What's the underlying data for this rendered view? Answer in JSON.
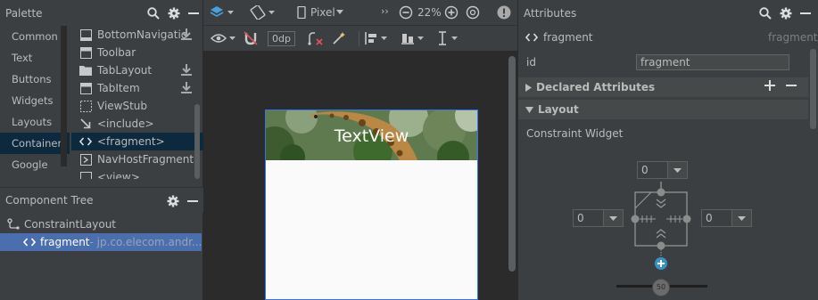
{
  "palette": {
    "title": "Palette",
    "categories": [
      "Common",
      "Text",
      "Buttons",
      "Widgets",
      "Layouts",
      "Container",
      "Google"
    ],
    "selected_category": "Container",
    "items": [
      {
        "label": "BottomNavigatio",
        "icon": "bottom-nav-icon",
        "download": true
      },
      {
        "label": "Toolbar",
        "icon": "toolbar-icon",
        "download": false
      },
      {
        "label": "TabLayout",
        "icon": "folder-icon",
        "download": true
      },
      {
        "label": "TabItem",
        "icon": "tab-item-icon",
        "download": true
      },
      {
        "label": "ViewStub",
        "icon": "viewstub-icon",
        "download": false
      },
      {
        "label": "<include>",
        "icon": "include-arrow-icon",
        "download": false
      },
      {
        "label": "<fragment>",
        "icon": "code-brackets-icon",
        "download": false
      },
      {
        "label": "NavHostFragment",
        "icon": "nav-host-icon",
        "download": false
      },
      {
        "label": "<view>",
        "icon": "view-icon",
        "download": false
      }
    ],
    "selected_item": "<fragment>"
  },
  "component_tree": {
    "title": "Component Tree",
    "root": "ConstraintLayout",
    "child_label": "fragment",
    "child_detail": "- jp.co.elecom.andr..."
  },
  "toolbar": {
    "device": "Pixel",
    "zoom": "22%",
    "margin": "0dp"
  },
  "preview": {
    "textview_text": "TextView"
  },
  "attributes": {
    "title": "Attributes",
    "component_name": "fragment",
    "component_type": "fragment",
    "id_label": "id",
    "id_value": "fragment",
    "declared_section": "Declared Attributes",
    "layout_section": "Layout",
    "constraint_label": "Constraint Widget",
    "margin_top": "0",
    "margin_left": "0",
    "margin_right": "0",
    "bias": "50"
  },
  "colors": {
    "panel_bg": "#3c3f41",
    "editor_bg": "#2b2b2b",
    "selection": "#4b6eaf",
    "accent_blue": "#3574f0",
    "add_constraint": "#3592c4"
  }
}
